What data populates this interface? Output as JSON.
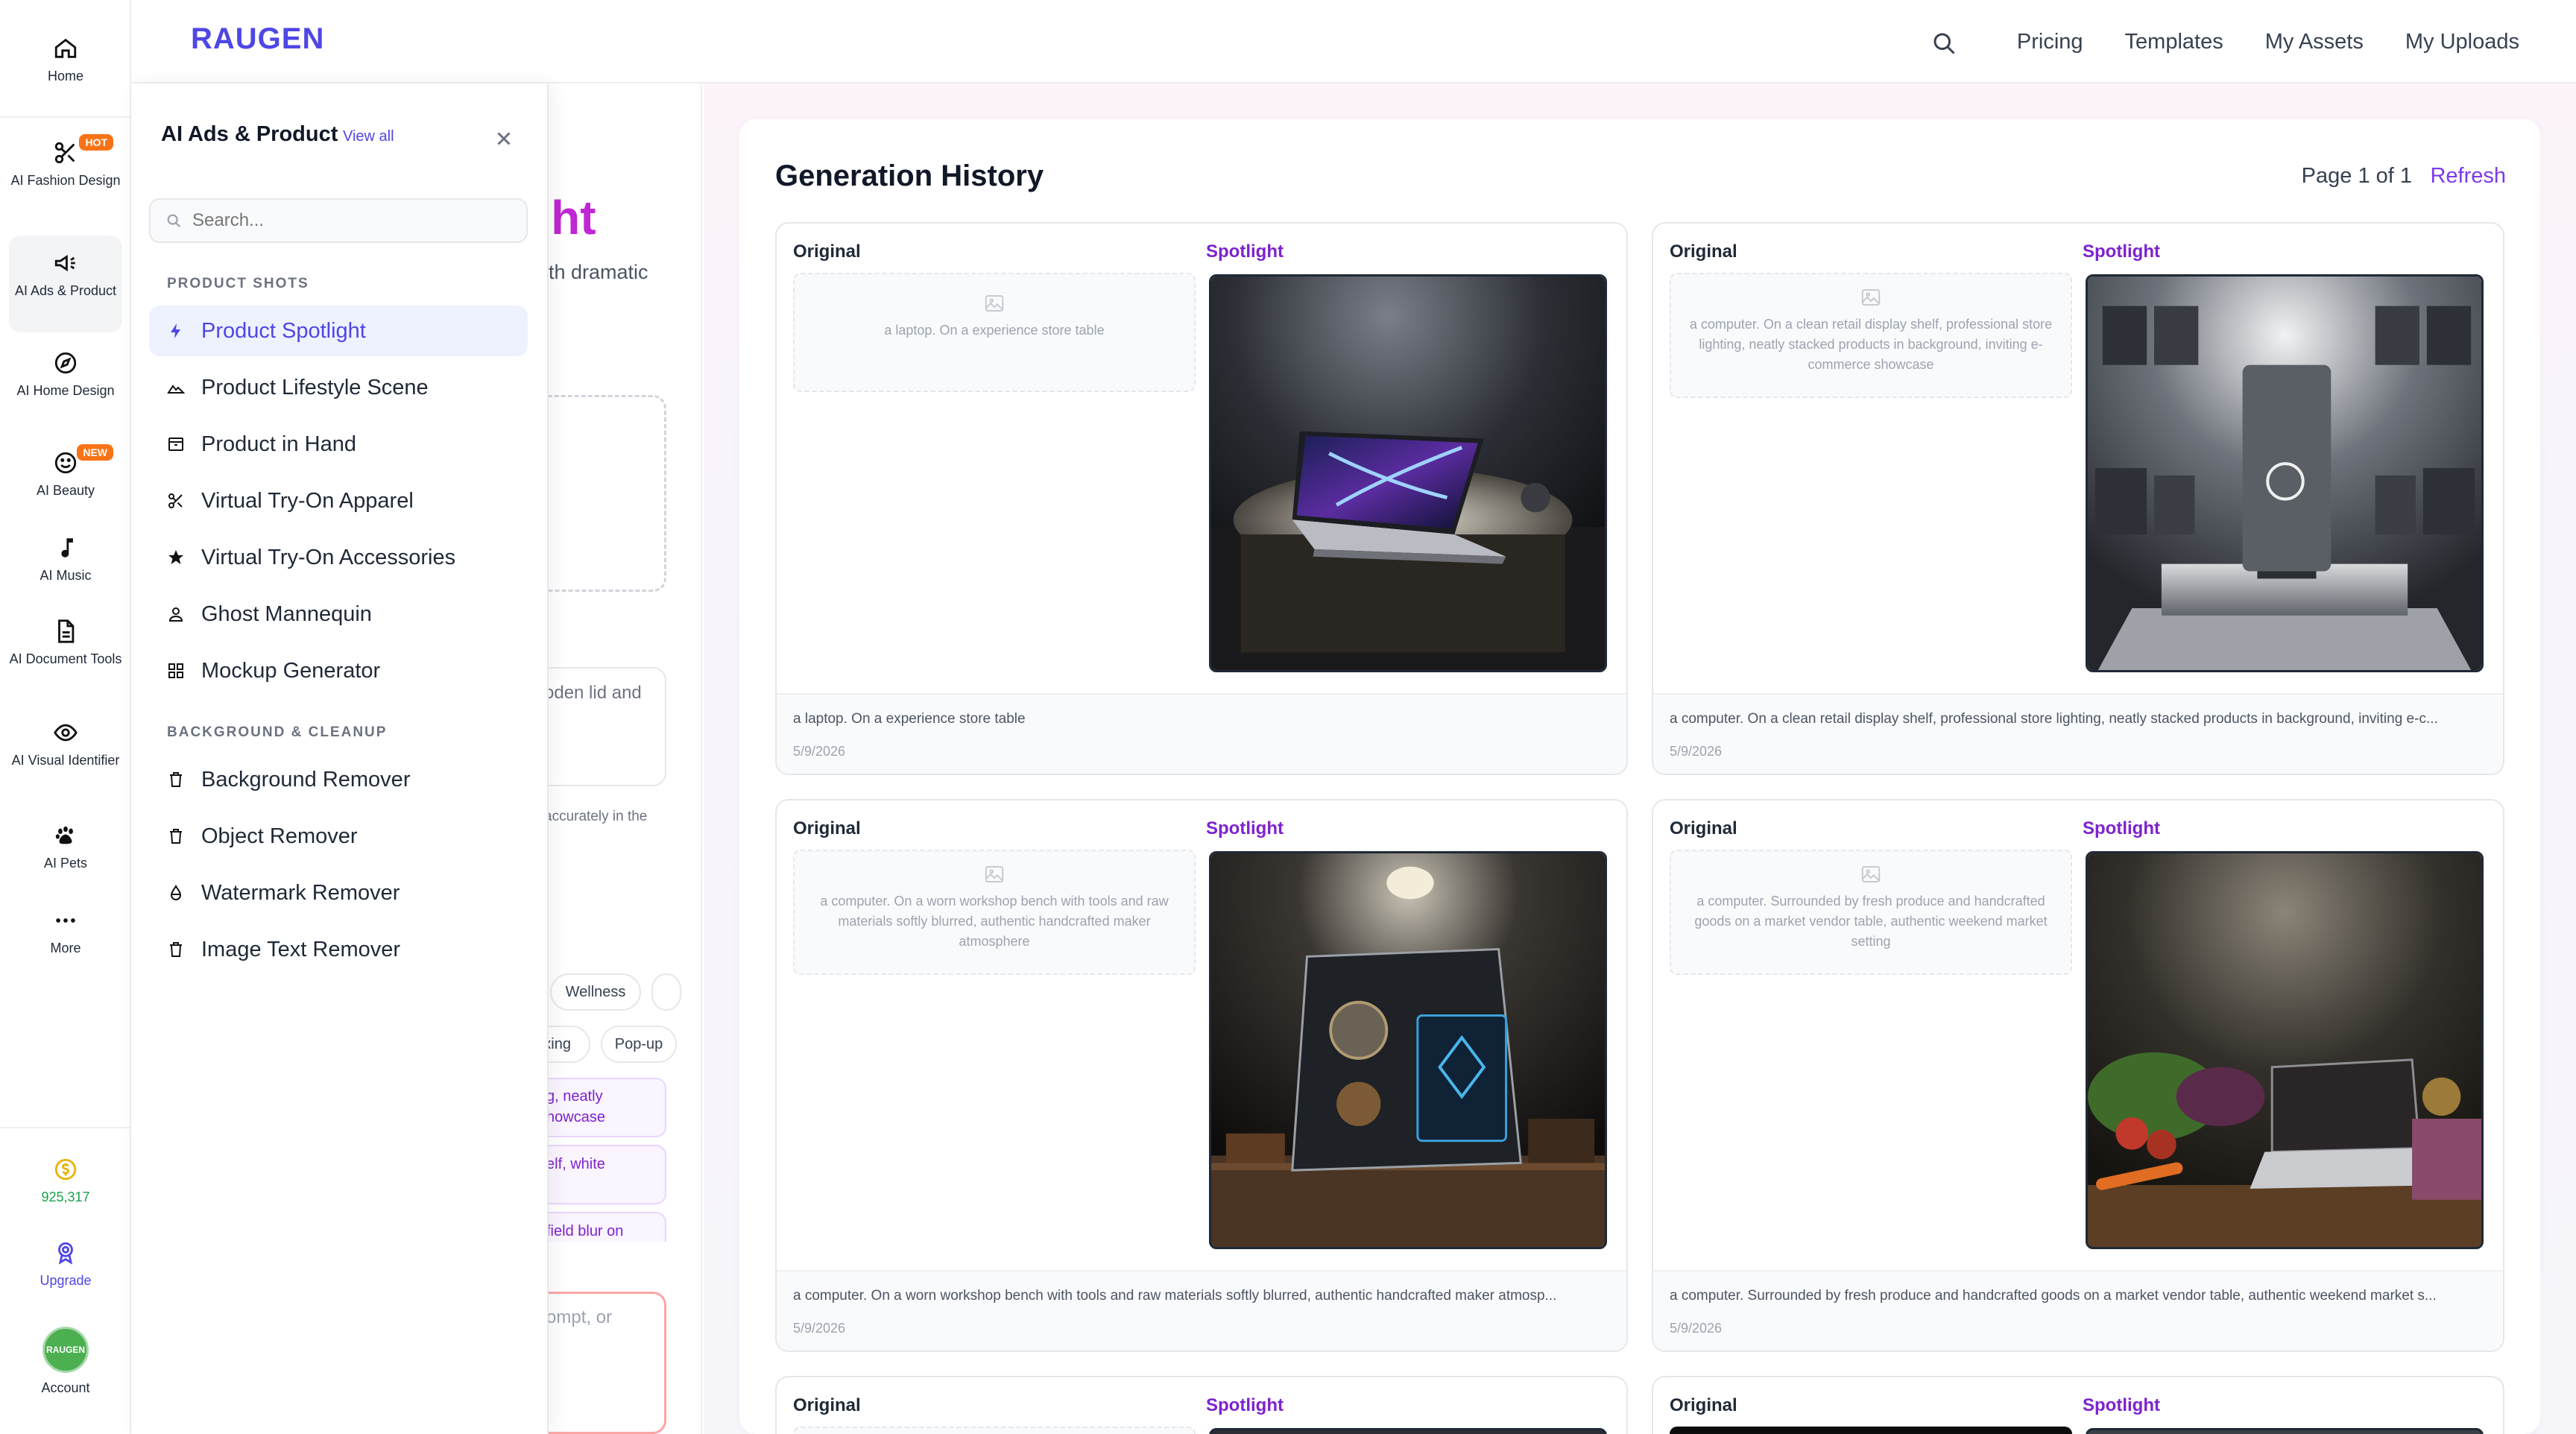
{
  "rail": {
    "items": [
      {
        "label": "Home",
        "icon": "home-icon"
      },
      {
        "label": "AI Fashion Design",
        "icon": "scissors-icon",
        "badge": "HOT"
      },
      {
        "label": "AI Ads & Product",
        "icon": "megaphone-icon"
      },
      {
        "label": "AI Home Design",
        "icon": "compass-icon"
      },
      {
        "label": "AI Beauty",
        "icon": "smile-icon",
        "badge": "NEW"
      },
      {
        "label": "AI Music",
        "icon": "music-note-icon"
      },
      {
        "label": "AI Document Tools",
        "icon": "document-icon"
      },
      {
        "label": "AI Visual Identifier",
        "icon": "eye-icon"
      },
      {
        "label": "AI Pets",
        "icon": "paw-icon"
      },
      {
        "label": "More",
        "icon": "more-dots-icon"
      }
    ],
    "credits": "925,317",
    "upgrade": "Upgrade",
    "account": "Account",
    "avatar_text": "RAUGEN"
  },
  "header": {
    "brand": "RAUGEN",
    "nav": [
      "Pricing",
      "Templates",
      "My Assets",
      "My Uploads"
    ]
  },
  "background_form": {
    "heading_fragment": "ght",
    "subtitle_fragment": "ith dramatic",
    "box_text_fragment": "oden lid and",
    "small_fragment": "accurately in the",
    "chips": [
      "Wellness",
      "xing",
      "Pop-up"
    ],
    "suggestions": [
      [
        "g, neatly",
        "howcase"
      ],
      [
        "elf, white"
      ],
      [
        "field blur on"
      ]
    ],
    "prompt_fragment": "ompt, or"
  },
  "flyout": {
    "title": "AI Ads & Product",
    "view_all": "View all",
    "search_placeholder": "Search...",
    "sections": [
      {
        "title": "PRODUCT SHOTS",
        "items": [
          {
            "label": "Product Spotlight",
            "icon": "lightning-icon",
            "active": true
          },
          {
            "label": "Product Lifestyle Scene",
            "icon": "landscape-icon"
          },
          {
            "label": "Product in Hand",
            "icon": "box-icon"
          },
          {
            "label": "Virtual Try-On Apparel",
            "icon": "scissors-icon"
          },
          {
            "label": "Virtual Try-On Accessories",
            "icon": "star-icon"
          },
          {
            "label": "Ghost Mannequin",
            "icon": "person-icon"
          },
          {
            "label": "Mockup Generator",
            "icon": "grid-icon"
          }
        ]
      },
      {
        "title": "BACKGROUND & CLEANUP",
        "items": [
          {
            "label": "Background Remover",
            "icon": "trash-icon"
          },
          {
            "label": "Object Remover",
            "icon": "trash-icon"
          },
          {
            "label": "Watermark Remover",
            "icon": "droplet-icon"
          },
          {
            "label": "Image Text Remover",
            "icon": "trash-icon"
          }
        ]
      }
    ]
  },
  "history": {
    "title": "Generation History",
    "page_info": "Page 1 of 1",
    "refresh": "Refresh",
    "original_label": "Original",
    "result_label": "Spotlight",
    "cards": [
      {
        "prompt": "a laptop. On a experience store table",
        "caption": "a laptop. On a experience store table",
        "date": "5/9/2026"
      },
      {
        "prompt": "a computer. On a clean retail display shelf, professional store lighting, neatly stacked products in background, inviting e-commerce showcase",
        "caption": "a computer. On a clean retail display shelf, professional store lighting, neatly stacked products in background, inviting e-c...",
        "date": "5/9/2026"
      },
      {
        "prompt": "a computer. On a worn workshop bench with tools and raw materials softly blurred, authentic handcrafted maker atmosphere",
        "caption": "a computer. On a worn workshop bench with tools and raw materials softly blurred, authentic handcrafted maker atmosp...",
        "date": "5/9/2026"
      },
      {
        "prompt": "a computer. Surrounded by fresh produce and handcrafted goods on a market vendor table, authentic weekend market setting",
        "caption": "a computer. Surrounded by fresh produce and handcrafted goods on a market vendor table, authentic weekend market s...",
        "date": "5/9/2026"
      }
    ]
  },
  "colors": {
    "brand": "#4f46e5",
    "accent_purple": "#7e22ce",
    "hot_badge": "#f97316",
    "credits_green": "#16a34a"
  }
}
